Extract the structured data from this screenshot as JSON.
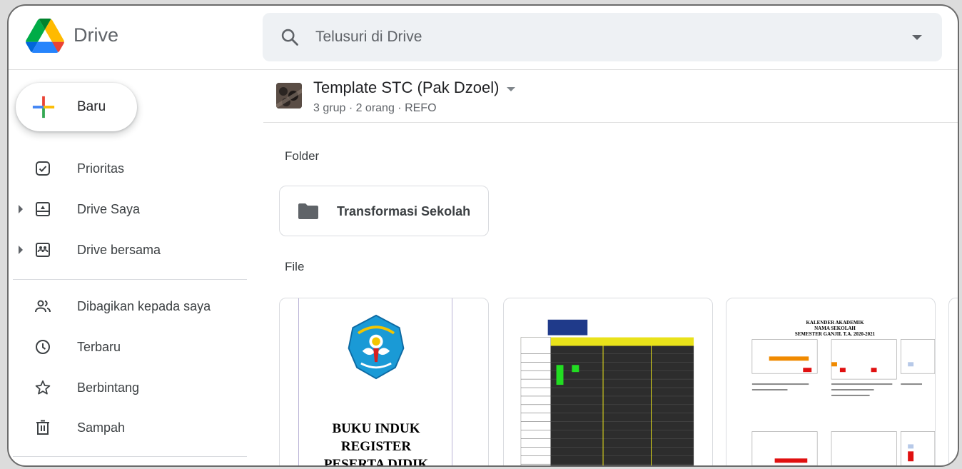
{
  "header": {
    "app_name": "Drive",
    "search_placeholder": "Telusuri di Drive"
  },
  "sidebar": {
    "new_label": "Baru",
    "items": [
      {
        "label": "Prioritas",
        "icon": "checkbox-icon"
      },
      {
        "label": "Drive Saya",
        "icon": "my-drive-icon"
      },
      {
        "label": "Drive bersama",
        "icon": "shared-drives-icon"
      },
      {
        "label": "Dibagikan kepada saya",
        "icon": "people-icon"
      },
      {
        "label": "Terbaru",
        "icon": "clock-icon"
      },
      {
        "label": "Berbintang",
        "icon": "star-icon"
      },
      {
        "label": "Sampah",
        "icon": "trash-icon"
      }
    ]
  },
  "main": {
    "group_title": "Template STC (Pak Dzoel)",
    "group_subtitle": "3 grup · 2 orang · REFO",
    "folder_section": "Folder",
    "folders": [
      {
        "name": "Transformasi Sekolah"
      }
    ],
    "file_section": "File",
    "files": [
      {
        "title_lines": [
          "BUKU INDUK",
          "REGISTER",
          "PESERTA DIDIK"
        ],
        "kind": "document"
      },
      {
        "kind": "spreadsheet"
      },
      {
        "kind": "calendar",
        "title_lines": [
          "KALENDER AKADEMIK",
          "NAMA SEKOLAH",
          "SEMESTER GANJIL T.A. 2020-2021"
        ]
      }
    ]
  },
  "colors": {
    "google_blue": "#4285f4",
    "google_red": "#ea4335",
    "google_yellow": "#fbbc04",
    "google_green": "#34a853",
    "icon_gray": "#5f6368"
  }
}
